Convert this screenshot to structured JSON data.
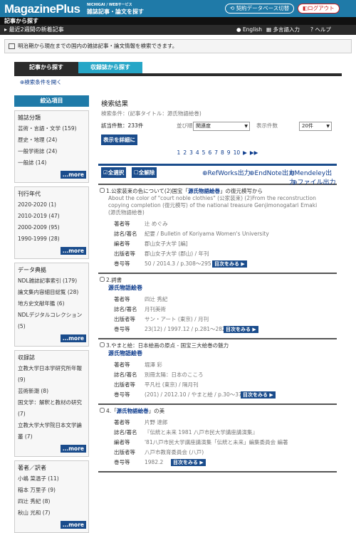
{
  "header": {
    "logo": "MagazinePlus",
    "tag1": "NICHIGAI / WEBサービス",
    "tag2": "雑誌記事・論文を探す",
    "btn_db": "契約データベース切替",
    "btn_logout": "ログアウト"
  },
  "nav": {
    "crumb": "記事から探す",
    "latest": "最近2週間の新着記事",
    "english": "English",
    "multi": "多言語入力",
    "help": "ヘルプ"
  },
  "info": "明治期から現在までの国内の雑誌記事・論文情報を検索できます。",
  "tabs": [
    "記事から探す",
    "収録誌から探す"
  ],
  "open_cond": "検索条件を開く",
  "sidebar": {
    "head": "絞込項目",
    "more": "...more",
    "groups": [
      {
        "title": "雑誌分類",
        "items": [
          "芸術・言語・文学 (159)",
          "歴史・地理 (24)",
          "一般学術誌 (24)",
          "一般誌 (14)"
        ]
      },
      {
        "title": "刊行年代",
        "items": [
          "2020-2020 (1)",
          "2010-2019 (47)",
          "2000-2009 (95)",
          "1990-1999 (28)"
        ]
      },
      {
        "title": "データ典拠",
        "items": [
          "NDL雑誌記事索引 (179)",
          "論文集内容細目総覧 (28)",
          "地方史文献年鑑 (6)",
          "NDLデジタルコレクション (5)"
        ]
      },
      {
        "title": "収録誌",
        "items": [
          "立教大学日本学研究所年報 (9)",
          "芸術新潮 (8)",
          "国文学：解釈と教材の研究 (7)",
          "立教大学大学院日本文学論叢 (7)"
        ]
      },
      {
        "title": "著者／訳者",
        "items": [
          "小嶋 菜温子 (11)",
          "稲本 万里子 (9)",
          "四辻 秀紀 (8)",
          "秋山 光和 (7)"
        ]
      }
    ]
  },
  "main": {
    "title": "検索結果",
    "cond": "検索条件：(記事タイトル：源氏物語絵巻)",
    "count": "該当件数：233件",
    "sort_label": "並び順",
    "sort_value": "関連度",
    "per_label": "表示件数",
    "per_value": "20件",
    "detail_btn": "表示を詳細に",
    "pages": [
      "1",
      "2",
      "3",
      "4",
      "5",
      "6",
      "7",
      "8",
      "9",
      "10",
      "▶",
      "▶▶"
    ],
    "select_all": "全選択",
    "clear_all": "全解除",
    "exports": [
      "RefWorks出力",
      "EndNote出力",
      "Mendeley出力"
    ],
    "file_out": "ファイル出力",
    "show_toc": "目次をみる ▶",
    "records": [
      {
        "num": "1.",
        "title_pre": "公家装束の色について(2)国宝「",
        "title_hl": "源氏物語絵巻",
        "title_post": "」の復元模写から",
        "sub": [
          "About the color of \"court noble clothies\" (公家装束) (2)From the reconstruction",
          "copying completion (復元模写) of the national treasure Genjimonogatari Emaki",
          "(源氏物語絵巻)"
        ],
        "fields": [
          [
            "著者等",
            "辻 めぐみ"
          ],
          [
            "誌名/著名",
            "紀要 / Bulletin of Koriyama Women's University"
          ],
          [
            "編者等",
            "郡山女子大学 [編]"
          ],
          [
            "出版者等",
            "郡山女子大学 (郡山) / 年刊"
          ],
          [
            "巻号等",
            "50 / 2014.3 / p.308〜295"
          ]
        ]
      },
      {
        "num": "2.",
        "title_pre": "詞書",
        "title_hl": "",
        "title_post": "",
        "green": "源氏物語絵巻",
        "fields": [
          [
            "著者等",
            "四辻 秀紀"
          ],
          [
            "誌名/著名",
            "月刊美術"
          ],
          [
            "出版者等",
            "サン・アート (東京) / 月刊"
          ],
          [
            "巻号等",
            "23(12) / 1997.12 / p.281〜282"
          ]
        ]
      },
      {
        "num": "3.",
        "title_pre": "やまと絵：日本絵画の原点 - 国宝三大絵巻の魅力",
        "title_hl": "",
        "title_post": "",
        "green": "源氏物語絵巻",
        "fields": [
          [
            "著者等",
            "堀澤 彩"
          ],
          [
            "誌名/著名",
            "別冊太陽：日本のこころ"
          ],
          [
            "出版者等",
            "平凡社 (東京) / 隔月刊"
          ],
          [
            "巻号等",
            "(201) / 2012.10 / やまと絵 / p.30〜37"
          ]
        ]
      },
      {
        "num": "4.",
        "title_pre": "「",
        "title_hl": "源氏物語絵巻",
        "title_post": "」の美",
        "fields": [
          [
            "著者等",
            "片野 達郎"
          ],
          [
            "誌名/著名",
            "『伝統と未来 1981 八戸市民大学講座講演集』"
          ],
          [
            "編者等",
            "'81八戸市民大学講座講演集「伝統と未来」編集委員会 編著"
          ],
          [
            "出版者等",
            "八戸市教育委員会 (八戸)"
          ],
          [
            "巻号等",
            "1982.2"
          ]
        ]
      }
    ]
  },
  "colors": {
    "brand": "#1f7aa8",
    "dark": "#1a4c8c",
    "tab_active": "#2b2b2b",
    "tab_inactive": "#26a6c7"
  }
}
